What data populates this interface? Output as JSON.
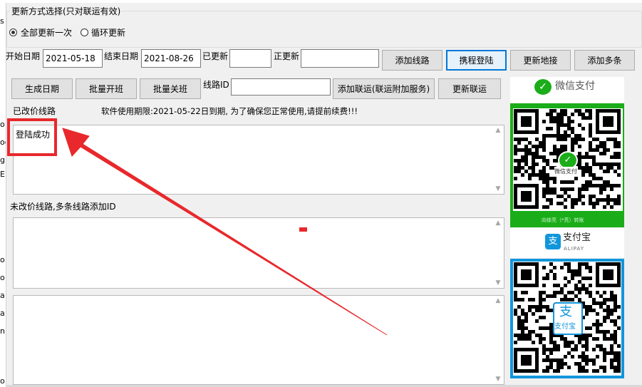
{
  "group": {
    "title": "更新方式选择(只对联运有效)"
  },
  "update_mode": {
    "options": [
      {
        "label": "全部更新一次",
        "checked": true
      },
      {
        "label": "循环更新",
        "checked": false
      }
    ]
  },
  "row1": {
    "start_date_label": "开始日期",
    "start_date_value": "2021-05-18",
    "end_date_label": "结束日期",
    "end_date_value": "2021-08-26",
    "updated_label": "已更新",
    "updated_value": "",
    "updating_label": "正更新",
    "updating_value": "",
    "add_route_button": "添加线路",
    "ctrip_login_button": "携程登陆",
    "update_connection_button": "更新地接",
    "add_multiple_button": "添加多条"
  },
  "row2": {
    "generate_date_button": "生成日期",
    "batch_open_button": "批量开班",
    "batch_close_button": "批量关班",
    "route_id_label": "线路ID",
    "route_id_value": "",
    "add_joint_button": "添加联运(联运附加服务)",
    "update_joint_button": "更新联运"
  },
  "status": {
    "changed_routes_label": "已改价线路",
    "notice": "软件使用期限:2021-05-22日到期, 为了确保您正常使用,请提前续费!!!",
    "login_message": "登陆成功",
    "unchanged_routes_label": "未改价线路,多条线路添加ID"
  },
  "payment": {
    "wechat_title": "微信支付",
    "wechat_caption": "向徐亮（*亮）转账",
    "wechat_center": "微信支付",
    "alipay_title": "支付宝",
    "alipay_subtitle": "ALIPAY",
    "alipay_center_glyph": "支",
    "alipay_center_text": "支付宝",
    "wechat_color": "#1aad19",
    "alipay_color": "#1296db"
  },
  "annotation": {
    "highlight_color": "#e8282c"
  },
  "left_edge_fragments": [
    "s",
    "o",
    "og",
    "g",
    "E",
    "o",
    "o",
    "a",
    "a",
    "n",
    "o"
  ]
}
